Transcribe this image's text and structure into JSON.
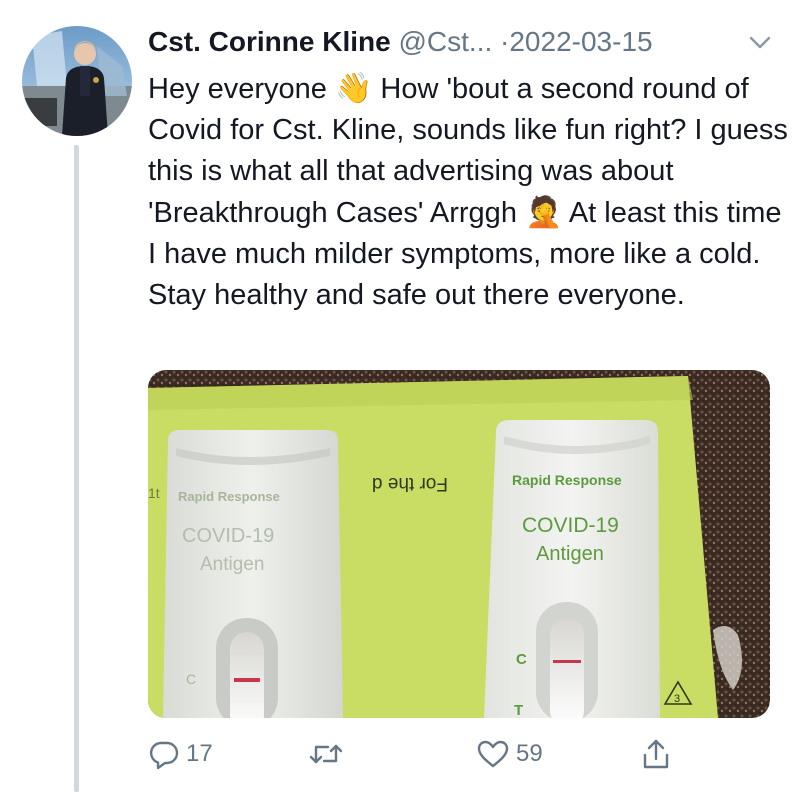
{
  "tweet": {
    "author_name": "Cst. Corinne Kline",
    "author_handle": "@Cst...",
    "separator": "·",
    "date": "2022-03-15",
    "text_segments": {
      "a": "Hey everyone ",
      "emoji_wave": "👋",
      "b": " How 'bout a second round of Covid for Cst. Kline, sounds like fun right? I guess this is what all that advertising was about 'Breakthrough Cases' Arrggh ",
      "emoji_facepalm": "🤦",
      "c": " At least this time I have much milder symptoms, more like a cold. Stay healthy and safe out there everyone."
    }
  },
  "media": {
    "left_test": {
      "brand": "Rapid Response",
      "line1": "COVID-19",
      "line2": "Antigen",
      "c_label": "C"
    },
    "right_test": {
      "brand": "Rapid Response",
      "line1": "COVID-19",
      "line2": "Antigen",
      "c_label": "C",
      "t_label": "T",
      "tri_label": "3"
    },
    "box_text": "For the d"
  },
  "actions": {
    "reply_count": "17",
    "retweet_count": "",
    "like_count": "59"
  },
  "colors": {
    "text": "#141823",
    "secondary": "#657786",
    "thread_line": "#cfd9de",
    "box_green": "#c9dc63",
    "test_white": "#ecedea",
    "test_text_green": "#5c9a3d",
    "control_line": "#c8364a"
  },
  "icons": [
    "avatar",
    "chevron-down-icon",
    "reply-icon",
    "retweet-icon",
    "like-icon",
    "share-icon"
  ]
}
